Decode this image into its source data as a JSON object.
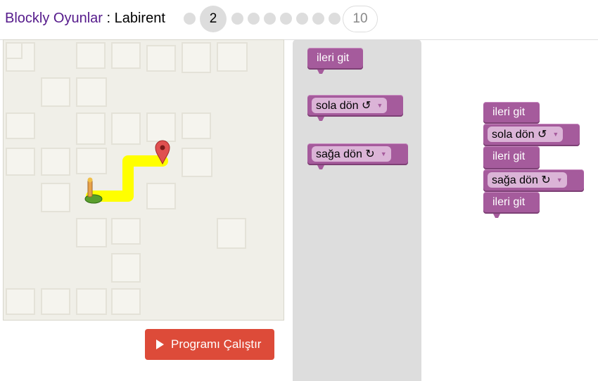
{
  "header": {
    "app_name": "Blockly Oyunlar",
    "separator": " : ",
    "game_name": "Labirent",
    "current_level": "2",
    "last_level": "10"
  },
  "run_button": {
    "label": "Programı Çalıştır",
    "icon": "play-icon"
  },
  "toolbox": {
    "blocks": [
      {
        "label": "ileri git"
      },
      {
        "label": "sola dön ↺"
      },
      {
        "label": "sağa dön ↻"
      }
    ]
  },
  "workspace": {
    "blocks": [
      {
        "label": "ileri git"
      },
      {
        "label": "sola dön ↺"
      },
      {
        "label": "ileri git"
      },
      {
        "label": "sağa dön ↻"
      },
      {
        "label": "ileri git"
      }
    ]
  },
  "colors": {
    "block": "#a55b9c",
    "run_button": "#dd4b39",
    "path": "#ffff00",
    "maze_bg": "#f0efe8",
    "title_link": "#551a8b"
  }
}
